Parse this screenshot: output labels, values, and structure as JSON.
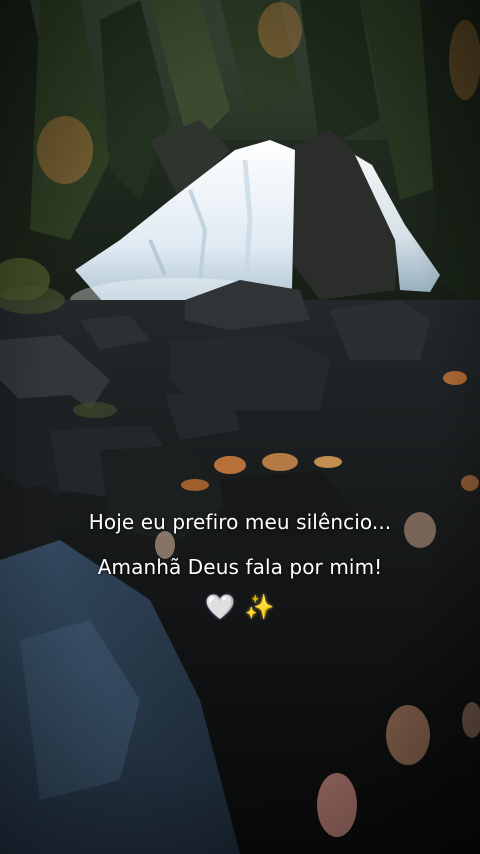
{
  "caption": {
    "line1": "Hoje eu prefiro meu silêncio...",
    "line2": "Amanhã Deus fala por mim!",
    "heart_emoji": "🤍",
    "sparkles_emoji": "✨"
  },
  "scene": {
    "description_icons": [
      "waterfall-icon",
      "forest-icon",
      "rocks-icon",
      "leaves-icon"
    ],
    "colors": {
      "sky": "#c9cfc9",
      "forest_dark": "#1f2b20",
      "water": "#e9f1f6",
      "rock": "#1a1c1b",
      "leaf": "#c97a3c",
      "stream": "#2b3f52"
    }
  }
}
